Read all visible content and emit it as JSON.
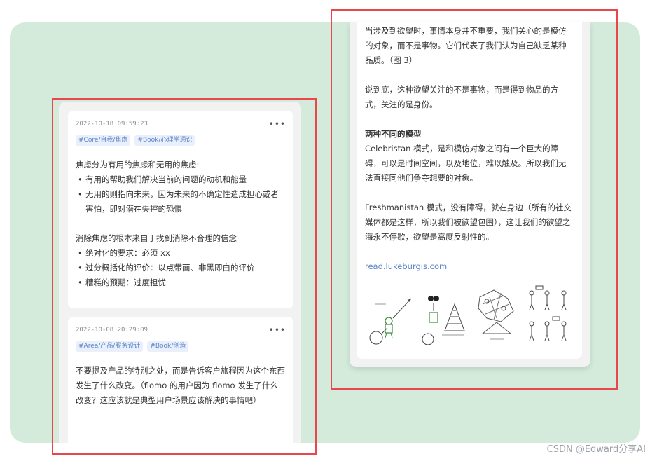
{
  "memos": [
    {
      "time": "2022-10-18 09:59:23",
      "tags": [
        "#Core/自我/焦虑",
        "#Book/心理学通识"
      ],
      "p1": "焦虑分为有用的焦虑和无用的焦虑:",
      "list1": [
        "有用的帮助我们解决当前的问题的动机和能量",
        "无用的则指向未来，因为未来的不确定性造成担心或者害怕，即对潜在失控的恐惧"
      ],
      "p2": "消除焦虑的根本来自于找到消除不合理的信念",
      "list2": [
        "绝对化的要求：必须 xx",
        "过分概括化的评价：以点带面、非黑即白的评价",
        "糟糕的预期：过度担忧"
      ]
    },
    {
      "time": "2022-10-08 20:29:09",
      "tags": [
        "#Area/产品/服务设计",
        "#Book/创造"
      ],
      "p1": "不要提及产品的特别之处，而是告诉客户旅程因为这个东西发生了什么改变。（flomo 的用户因为 flomo 发生了什么改变？这应该就是典型用户场景应该解决的事情吧）"
    }
  ],
  "more_glyph": "•••",
  "right": {
    "p1": "当涉及到欲望时，事情本身并不重要，我们关心的是模仿的对象，而不是事物。它们代表了我们认为自己缺乏某种品质。（图 3）",
    "p2": "说到底，这种欲望关注的不是事物，而是得到物品的方式，关注的是身份。",
    "heading": "两种不同的模型",
    "p3": "Celebristan 模式，是和模仿对象之间有一个巨大的障碍，可以是时间空间，以及地位，难以触及。所以我们无法直接同他们争夺想要的对象。",
    "p4": "Freshmanistan 模式，没有障碍，就在身边（所有的社交媒体都是这样，所以我们被欲望包围），这让我们的欲望之海永不停歇，欲望是高度反射性的。",
    "link": "read.lukeburgis.com"
  },
  "watermark": "CSDN @Edward分享AI",
  "colors": {
    "panel": "#d4ebdb",
    "highlight": "#e8484b",
    "tag_text": "#5a83c7",
    "tag_bg": "#eaf0fb"
  }
}
